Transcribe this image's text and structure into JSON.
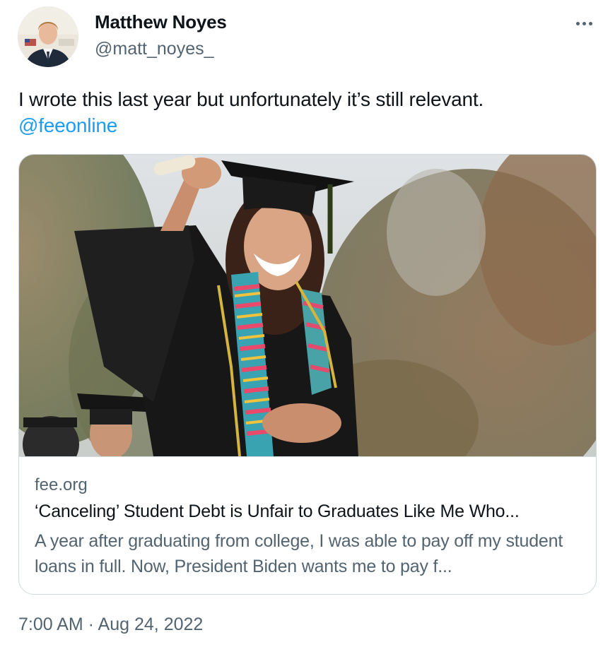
{
  "author": {
    "display_name": "Matthew Noyes",
    "handle": "@matt_noyes_",
    "avatar_icon": "profile-photo"
  },
  "more_icon": "more-options-icon",
  "tweet": {
    "text": "I wrote this last year but unfortunately it’s still relevant.",
    "mention": "@feeonline",
    "mention_color": "#1d9bf0"
  },
  "card": {
    "image_icon": "graduate-photo",
    "domain": "fee.org",
    "title": "‘Canceling’ Student Debt is Unfair to Graduates Like Me Who...",
    "description": "A year after graduating from college, I was able to pay off my student loans in full. Now, President Biden wants me to pay f..."
  },
  "timestamp": "7:00 AM · Aug 24, 2022",
  "colors": {
    "text": "#0f1419",
    "secondary": "#536471",
    "border": "#cfd9de",
    "link": "#1d9bf0"
  }
}
